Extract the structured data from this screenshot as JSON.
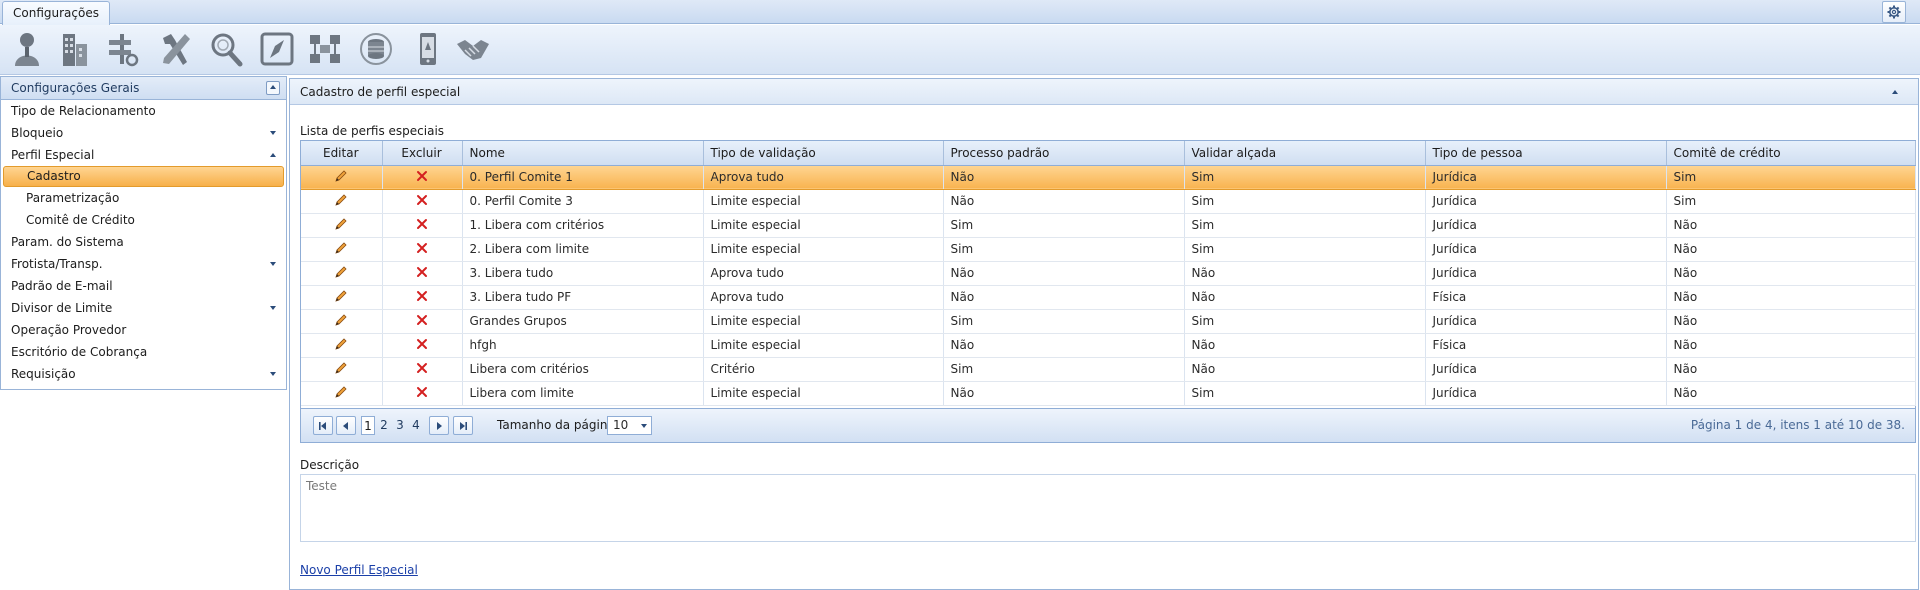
{
  "tabs": [
    {
      "label": "Configurações"
    }
  ],
  "toolbar_icons": [
    "user-silhouette-icon",
    "building-icon",
    "scale-settings-icon",
    "tools-icon",
    "magnifier-icon",
    "compass-icon",
    "network-icon",
    "database-icon",
    "mobile-icon",
    "handshake-icon"
  ],
  "sidebar": {
    "title": "Configurações Gerais",
    "items": [
      {
        "label": "Tipo de Relacionamento",
        "level": 0,
        "arrow": ""
      },
      {
        "label": "Bloqueio",
        "level": 0,
        "arrow": "down"
      },
      {
        "label": "Perfil Especial",
        "level": 0,
        "arrow": "up"
      },
      {
        "label": "Cadastro",
        "level": 1,
        "arrow": "",
        "selected": true
      },
      {
        "label": "Parametrização",
        "level": 1,
        "arrow": ""
      },
      {
        "label": "Comitê de Crédito",
        "level": 1,
        "arrow": ""
      },
      {
        "label": "Param. do Sistema",
        "level": 0,
        "arrow": ""
      },
      {
        "label": "Frotista/Transp.",
        "level": 0,
        "arrow": "down"
      },
      {
        "label": "Padrão de E-mail",
        "level": 0,
        "arrow": ""
      },
      {
        "label": "Divisor de Limite",
        "level": 0,
        "arrow": "down"
      },
      {
        "label": "Operação Provedor",
        "level": 0,
        "arrow": ""
      },
      {
        "label": "Escritório de Cobrança",
        "level": 0,
        "arrow": ""
      },
      {
        "label": "Requisição",
        "level": 0,
        "arrow": "down"
      }
    ]
  },
  "main": {
    "title": "Cadastro de perfil especial",
    "list_caption": "Lista de perfis especiais",
    "columns": [
      "Editar",
      "Excluir",
      "Nome",
      "Tipo de validação",
      "Processo padrão",
      "Validar alçada",
      "Tipo de pessoa",
      "Comitê de crédito"
    ],
    "rows": [
      {
        "nome": "0. Perfil Comite 1",
        "tipo": "Aprova tudo",
        "processo": "Não",
        "alcada": "Sim",
        "pessoa": "Jurídica",
        "comite": "Sim",
        "selected": true
      },
      {
        "nome": "0. Perfil Comite 3",
        "tipo": "Limite especial",
        "processo": "Não",
        "alcada": "Sim",
        "pessoa": "Jurídica",
        "comite": "Sim"
      },
      {
        "nome": "1. Libera com critérios",
        "tipo": "Limite especial",
        "processo": "Sim",
        "alcada": "Sim",
        "pessoa": "Jurídica",
        "comite": "Não"
      },
      {
        "nome": "2. Libera com limite",
        "tipo": "Limite especial",
        "processo": "Sim",
        "alcada": "Sim",
        "pessoa": "Jurídica",
        "comite": "Não"
      },
      {
        "nome": "3. Libera tudo",
        "tipo": "Aprova tudo",
        "processo": "Não",
        "alcada": "Não",
        "pessoa": "Jurídica",
        "comite": "Não"
      },
      {
        "nome": "3. Libera tudo PF",
        "tipo": "Aprova tudo",
        "processo": "Não",
        "alcada": "Não",
        "pessoa": "Física",
        "comite": "Não"
      },
      {
        "nome": "Grandes Grupos",
        "tipo": "Limite especial",
        "processo": "Sim",
        "alcada": "Sim",
        "pessoa": "Jurídica",
        "comite": "Não"
      },
      {
        "nome": "hfgh",
        "tipo": "Limite especial",
        "processo": "Não",
        "alcada": "Não",
        "pessoa": "Física",
        "comite": "Não"
      },
      {
        "nome": "Libera com critérios",
        "tipo": "Critério",
        "processo": "Sim",
        "alcada": "Não",
        "pessoa": "Jurídica",
        "comite": "Não"
      },
      {
        "nome": "Libera com limite",
        "tipo": "Limite especial",
        "processo": "Não",
        "alcada": "Sim",
        "pessoa": "Jurídica",
        "comite": "Não"
      }
    ],
    "pager": {
      "pages": [
        "1",
        "2",
        "3",
        "4"
      ],
      "current_page": "1",
      "page_size_label": "Tamanho da página:",
      "page_size": "10",
      "info": "Página 1 de 4, itens 1 até 10 de 38."
    },
    "description": {
      "label": "Descrição",
      "value": "Teste"
    },
    "new_link": "Novo Perfil Especial"
  },
  "colors": {
    "selection": "#f8b350",
    "header_bg": "#d0def1",
    "border": "#99b4d8",
    "link": "#1a3fa8",
    "delete_icon": "#d42020",
    "edit_icon": "#c8742a"
  }
}
